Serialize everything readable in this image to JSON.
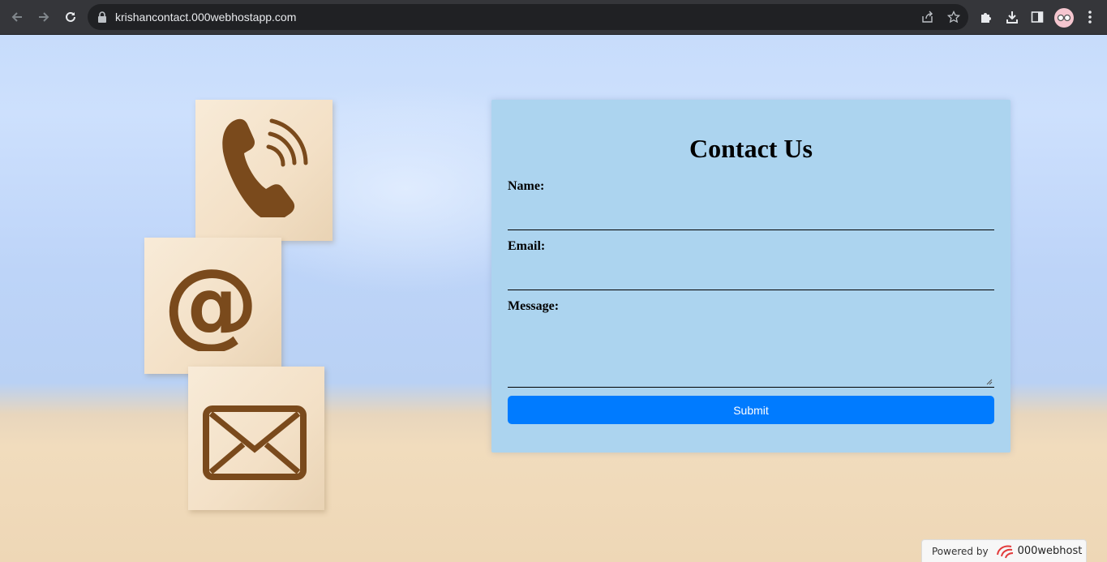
{
  "browser": {
    "url_host": "krishancontact.000webhostapp.com",
    "icons": [
      "back-icon",
      "forward-icon",
      "reload-icon",
      "lock-icon",
      "share-icon",
      "star-icon",
      "extensions-icon",
      "download-icon",
      "sidebar-icon",
      "profile-avatar",
      "kebab-menu-icon"
    ]
  },
  "page": {
    "blocks": [
      "phone-icon",
      "at-sign-icon",
      "envelope-icon"
    ],
    "form": {
      "title": "Contact Us",
      "name_label": "Name:",
      "email_label": "Email:",
      "message_label": "Message:",
      "submit_label": "Submit"
    },
    "powered": {
      "prefix": "Powered by",
      "brand": "000webhost"
    }
  },
  "colors": {
    "card_bg": "#acd4ef",
    "submit_bg": "#007bff",
    "block_icon": "#7a4a1c"
  }
}
